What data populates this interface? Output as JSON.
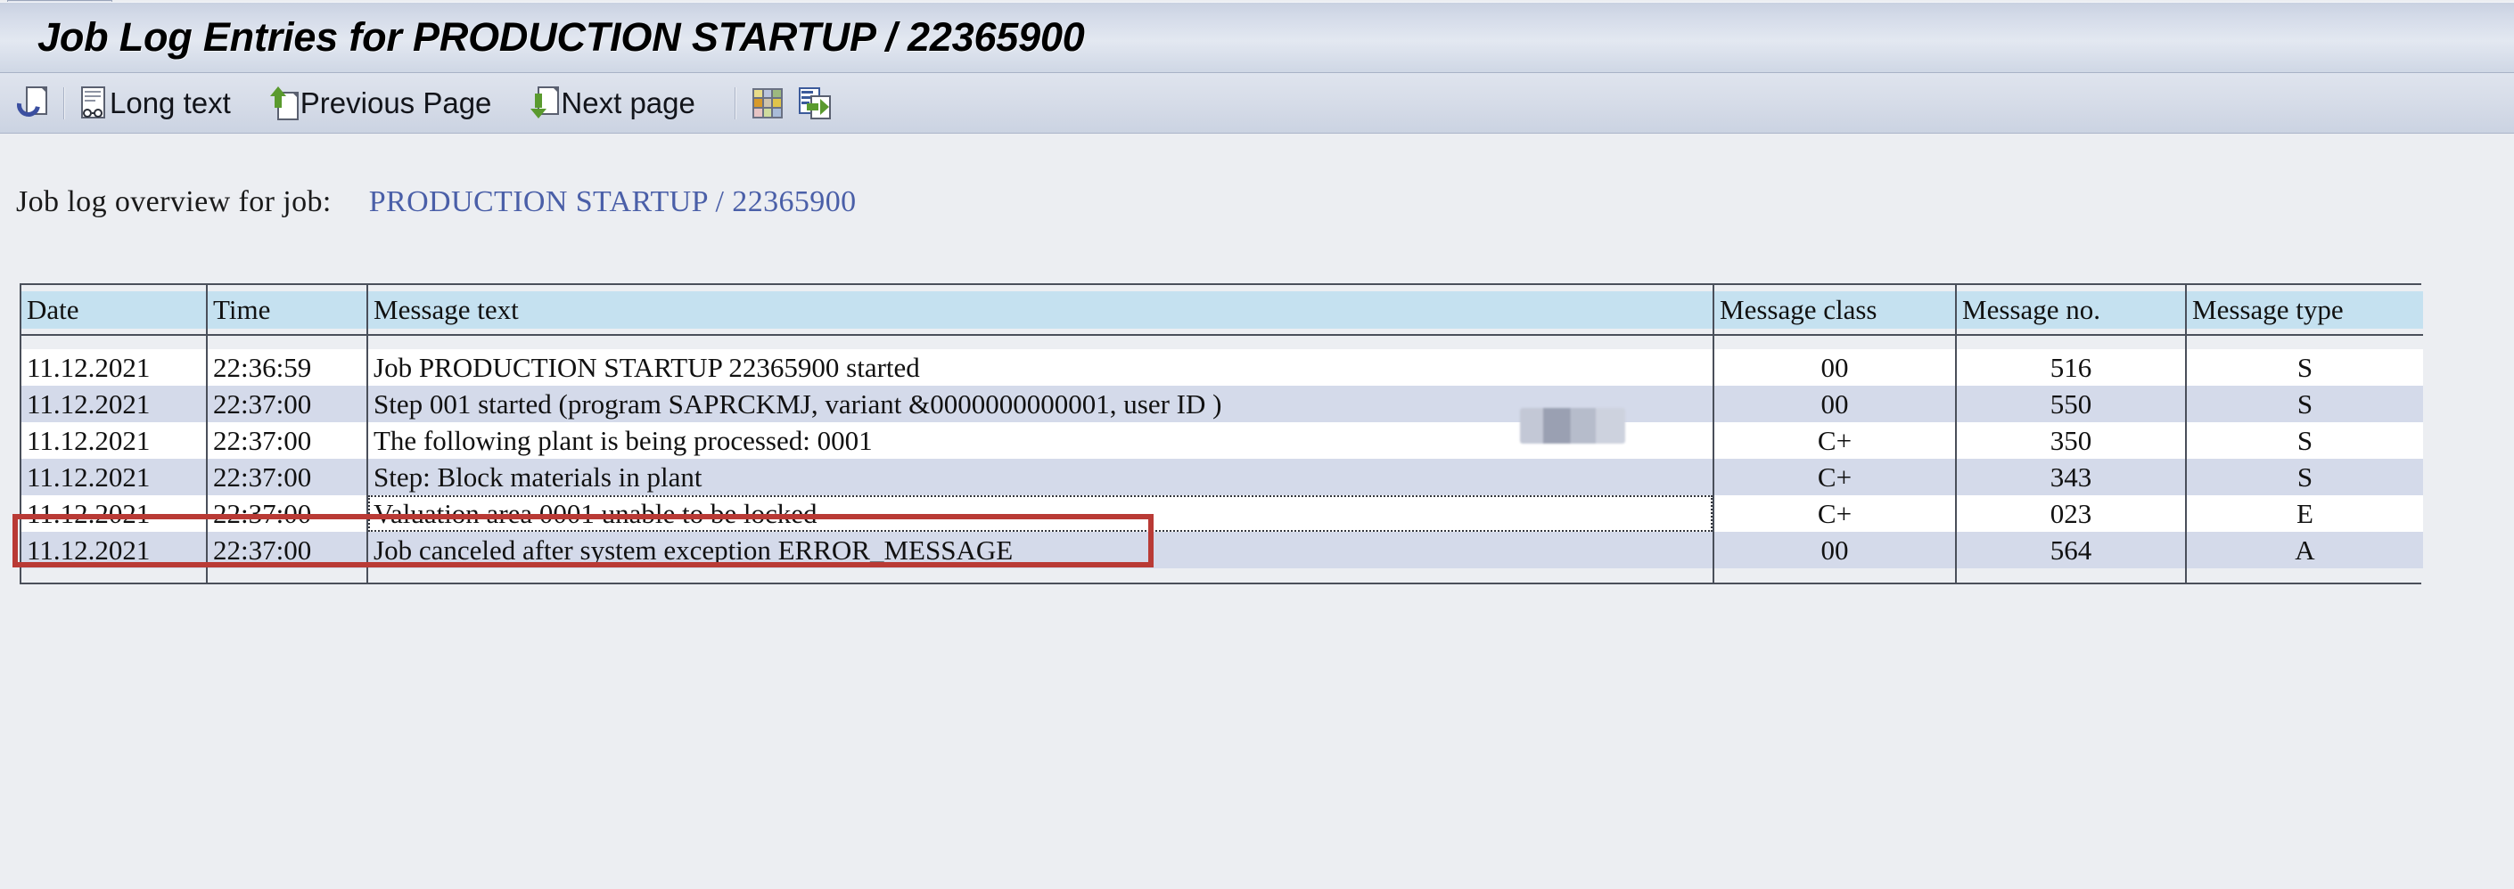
{
  "window": {
    "title": "Job Log Entries for PRODUCTION STARTUP / 22365900"
  },
  "toolbar": {
    "items": [
      {
        "icon": "refresh-icon",
        "label": ""
      },
      {
        "icon": "long-text-icon",
        "label": "Long text"
      },
      {
        "icon": "previous-page-icon",
        "label": "Previous Page"
      },
      {
        "icon": "next-page-icon",
        "label": "Next page"
      },
      {
        "icon": "color-grid-icon",
        "label": ""
      },
      {
        "icon": "export-to-document-icon",
        "label": ""
      }
    ],
    "refresh_label": "",
    "long_text_label": "Long text",
    "previous_page_label": "Previous Page",
    "next_page_label": "Next page"
  },
  "overview": {
    "label": "Job log overview for job:",
    "value": "PRODUCTION STARTUP / 22365900"
  },
  "table": {
    "columns": [
      "Date",
      "Time",
      "Message text",
      "Message class",
      "Message no.",
      "Message type"
    ],
    "rows": [
      {
        "date": "11.12.2021",
        "time": "22:36:59",
        "message": "Job PRODUCTION STARTUP 22365900 started",
        "message_class": "00",
        "message_no": "516",
        "message_type": "S"
      },
      {
        "date": "11.12.2021",
        "time": "22:37:00",
        "message": "Step 001 started (program SAPRCKMJ, variant &0000000000001, user ID         )",
        "message_class": "00",
        "message_no": "550",
        "message_type": "S"
      },
      {
        "date": "11.12.2021",
        "time": "22:37:00",
        "message": "The following plant is being processed: 0001",
        "message_class": "C+",
        "message_no": "350",
        "message_type": "S"
      },
      {
        "date": "11.12.2021",
        "time": "22:37:00",
        "message": "Step: Block materials in plant",
        "message_class": "C+",
        "message_no": "343",
        "message_type": "S"
      },
      {
        "date": "11.12.2021",
        "time": "22:37:00",
        "message": "Valuation area 0001 unable to be locked",
        "message_class": "C+",
        "message_no": "023",
        "message_type": "E"
      },
      {
        "date": "11.12.2021",
        "time": "22:37:00",
        "message": "Job canceled after system exception ERROR_MESSAGE",
        "message_class": "00",
        "message_no": "564",
        "message_type": "A"
      }
    ]
  },
  "annotation": {
    "color": "#b93a35",
    "target_row_index": 4
  },
  "colors": {
    "page_background": "#eceef2",
    "header_cell": "#c5e1f0",
    "row_odd": "#ffffff",
    "row_even": "#d4daea",
    "grid_line": "#4a4f5a",
    "link_text": "#4a5fa8",
    "annotation_red": "#b93a35"
  }
}
